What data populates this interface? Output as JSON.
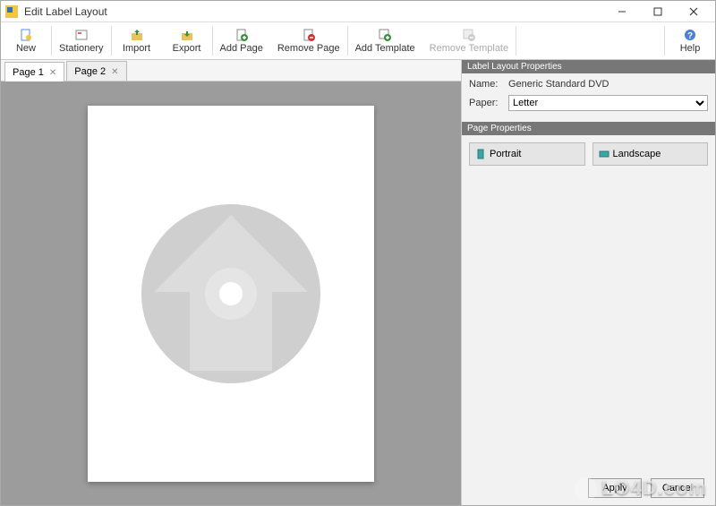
{
  "window": {
    "title": "Edit Label Layout"
  },
  "toolbar": {
    "new": "New",
    "stationery": "Stationery",
    "import": "Import",
    "export": "Export",
    "add_page": "Add Page",
    "remove_page": "Remove Page",
    "add_template": "Add Template",
    "remove_template": "Remove Template",
    "help": "Help"
  },
  "tabs": [
    {
      "label": "Page 1"
    },
    {
      "label": "Page 2"
    }
  ],
  "layout_props": {
    "section_title": "Label Layout Properties",
    "name_label": "Name:",
    "name_value": "Generic Standard DVD",
    "paper_label": "Paper:",
    "paper_value": "Letter"
  },
  "page_props": {
    "section_title": "Page Properties",
    "portrait": "Portrait",
    "landscape": "Landscape"
  },
  "buttons": {
    "apply": "Apply",
    "cancel": "Cancel"
  },
  "watermark": "LO4D.com",
  "colors": {
    "canvas_bg": "#9c9c9c",
    "panel_head": "#777777"
  }
}
